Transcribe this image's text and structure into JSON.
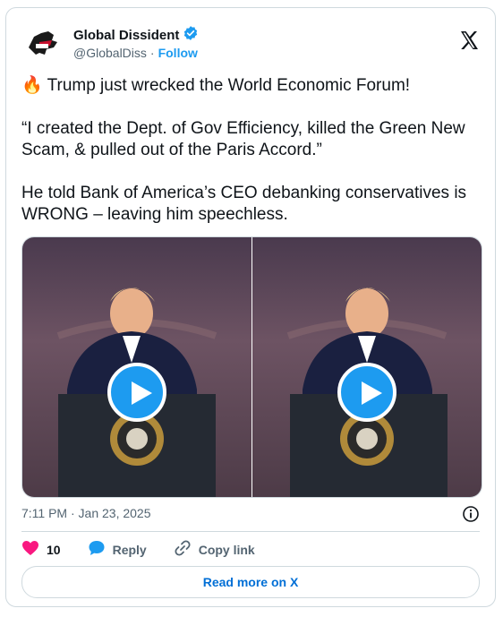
{
  "author": {
    "name": "Global Dissident",
    "handle": "@GlobalDiss",
    "separator": "·",
    "follow_label": "Follow"
  },
  "tweet": {
    "paragraphs": [
      "🔥 Trump just wrecked the World Economic Forum!",
      "“I created the Dept. of Gov Efficiency, killed the Green New Scam, & pulled out of the Paris Accord.”",
      "He told Bank of America’s CEO debanking conservatives is WRONG – leaving him speechless."
    ],
    "timestamp": "7:11 PM · Jan 23, 2025"
  },
  "actions": {
    "like_count": "10",
    "reply_label": "Reply",
    "copy_label": "Copy link"
  },
  "read_more_label": "Read more on X",
  "colors": {
    "accent": "#1d9bf0",
    "like": "#f91880",
    "link": "#006fd6"
  }
}
